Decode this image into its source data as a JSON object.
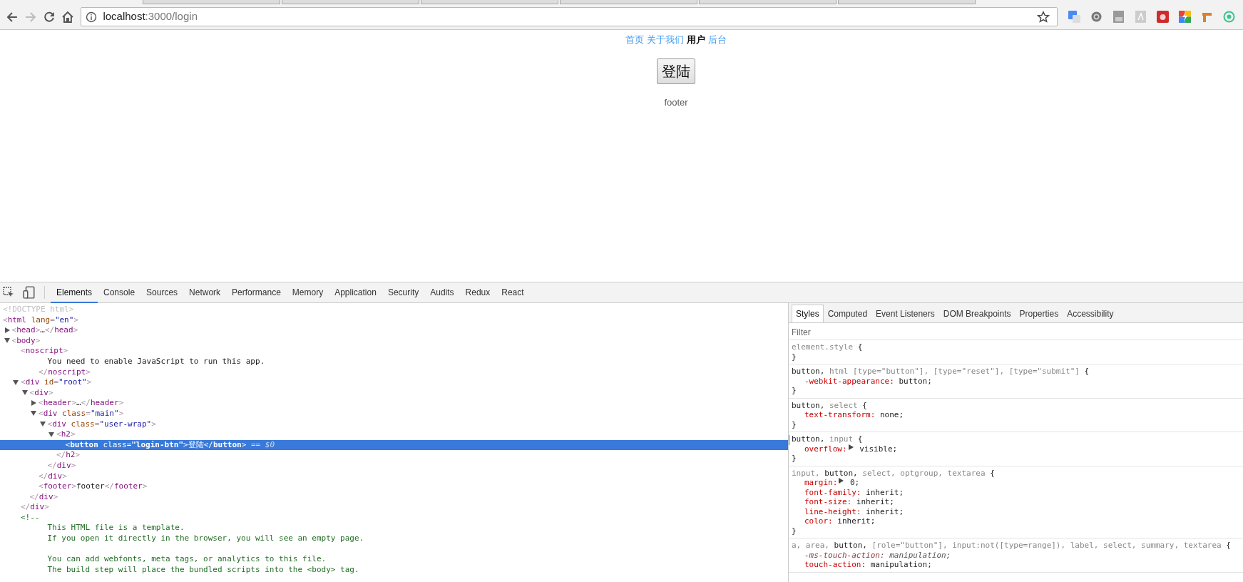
{
  "browser": {
    "url_host": "localhost",
    "url_path": ":3000/login"
  },
  "page": {
    "nav": [
      {
        "label": "首页",
        "selected": false
      },
      {
        "label": "关于我们",
        "selected": false
      },
      {
        "label": "用户",
        "selected": true
      },
      {
        "label": "后台",
        "selected": false
      }
    ],
    "login_button": "登陆",
    "footer": "footer"
  },
  "devtools": {
    "tabs": [
      {
        "label": "Elements",
        "selected": true
      },
      {
        "label": "Console",
        "selected": false
      },
      {
        "label": "Sources",
        "selected": false
      },
      {
        "label": "Network",
        "selected": false
      },
      {
        "label": "Performance",
        "selected": false
      },
      {
        "label": "Memory",
        "selected": false
      },
      {
        "label": "Application",
        "selected": false
      },
      {
        "label": "Security",
        "selected": false
      },
      {
        "label": "Audits",
        "selected": false
      },
      {
        "label": "Redux",
        "selected": false
      },
      {
        "label": "React",
        "selected": false
      }
    ],
    "dom": [
      {
        "selected": false,
        "open": [
          {
            "kind": "doctype",
            "text": "<!DOCTYPE html>"
          }
        ]
      },
      {
        "selected": false,
        "open": [
          {
            "kind": "punct",
            "text": "<"
          },
          {
            "kind": "tag",
            "text": "html"
          },
          {
            "kind": "attr",
            "text": " lang"
          },
          {
            "kind": "punct",
            "text": "="
          },
          {
            "kind": "val",
            "text": "\"en\""
          },
          {
            "kind": "punct",
            "text": ">"
          }
        ],
        "children": [
          {
            "selected": false,
            "expanded": false,
            "open": [
              {
                "kind": "punct",
                "text": "<"
              },
              {
                "kind": "tag",
                "text": "head"
              },
              {
                "kind": "punct",
                "text": ">"
              },
              {
                "kind": "text",
                "text": "…"
              },
              {
                "kind": "punct",
                "text": "</"
              },
              {
                "kind": "tag",
                "text": "head"
              },
              {
                "kind": "punct",
                "text": ">"
              }
            ]
          },
          {
            "selected": false,
            "expanded": true,
            "open": [
              {
                "kind": "punct",
                "text": "<"
              },
              {
                "kind": "tag",
                "text": "body"
              },
              {
                "kind": "punct",
                "text": ">"
              }
            ],
            "children": [
              {
                "selected": false,
                "open": [
                  {
                    "kind": "punct",
                    "text": "<"
                  },
                  {
                    "kind": "tag",
                    "text": "noscript"
                  },
                  {
                    "kind": "punct",
                    "text": ">"
                  }
                ],
                "children": [
                  {
                    "selected": false,
                    "text": "You need to enable JavaScript to run this app."
                  }
                ],
                "close": [
                  {
                    "kind": "punct",
                    "text": "</"
                  },
                  {
                    "kind": "tag",
                    "text": "noscript"
                  },
                  {
                    "kind": "punct",
                    "text": ">"
                  }
                ]
              },
              {
                "selected": false,
                "expanded": true,
                "open": [
                  {
                    "kind": "punct",
                    "text": "<"
                  },
                  {
                    "kind": "tag",
                    "text": "div"
                  },
                  {
                    "kind": "attr",
                    "text": " id"
                  },
                  {
                    "kind": "punct",
                    "text": "="
                  },
                  {
                    "kind": "val",
                    "text": "\"root\""
                  },
                  {
                    "kind": "punct",
                    "text": ">"
                  }
                ],
                "children": [
                  {
                    "selected": false,
                    "expanded": true,
                    "open": [
                      {
                        "kind": "punct",
                        "text": "<"
                      },
                      {
                        "kind": "tag",
                        "text": "div"
                      },
                      {
                        "kind": "punct",
                        "text": ">"
                      }
                    ],
                    "children": [
                      {
                        "selected": false,
                        "expanded": false,
                        "open": [
                          {
                            "kind": "punct",
                            "text": "<"
                          },
                          {
                            "kind": "tag",
                            "text": "header"
                          },
                          {
                            "kind": "punct",
                            "text": ">"
                          },
                          {
                            "kind": "text",
                            "text": "…"
                          },
                          {
                            "kind": "punct",
                            "text": "</"
                          },
                          {
                            "kind": "tag",
                            "text": "header"
                          },
                          {
                            "kind": "punct",
                            "text": ">"
                          }
                        ]
                      },
                      {
                        "selected": false,
                        "expanded": true,
                        "open": [
                          {
                            "kind": "punct",
                            "text": "<"
                          },
                          {
                            "kind": "tag",
                            "text": "div"
                          },
                          {
                            "kind": "attr",
                            "text": " class"
                          },
                          {
                            "kind": "punct",
                            "text": "="
                          },
                          {
                            "kind": "val",
                            "text": "\"main\""
                          },
                          {
                            "kind": "punct",
                            "text": ">"
                          }
                        ],
                        "children": [
                          {
                            "selected": false,
                            "expanded": true,
                            "open": [
                              {
                                "kind": "punct",
                                "text": "<"
                              },
                              {
                                "kind": "tag",
                                "text": "div"
                              },
                              {
                                "kind": "attr",
                                "text": " class"
                              },
                              {
                                "kind": "punct",
                                "text": "="
                              },
                              {
                                "kind": "val",
                                "text": "\"user-wrap\""
                              },
                              {
                                "kind": "punct",
                                "text": ">"
                              }
                            ],
                            "children": [
                              {
                                "selected": false,
                                "expanded": true,
                                "open": [
                                  {
                                    "kind": "punct",
                                    "text": "<"
                                  },
                                  {
                                    "kind": "tag",
                                    "text": "h2"
                                  },
                                  {
                                    "kind": "punct",
                                    "text": ">"
                                  }
                                ],
                                "children": [
                                  {
                                    "selected": true,
                                    "marker": " == $0",
                                    "open": [
                                      {
                                        "kind": "punct",
                                        "text": "<"
                                      },
                                      {
                                        "kind": "tag",
                                        "text": "button"
                                      },
                                      {
                                        "kind": "attr",
                                        "text": " class"
                                      },
                                      {
                                        "kind": "punct",
                                        "text": "="
                                      },
                                      {
                                        "kind": "val",
                                        "text": "\"login-btn\""
                                      },
                                      {
                                        "kind": "punct",
                                        "text": ">"
                                      },
                                      {
                                        "kind": "text",
                                        "text": "登陆"
                                      },
                                      {
                                        "kind": "punct",
                                        "text": "</"
                                      },
                                      {
                                        "kind": "tag",
                                        "text": "button"
                                      },
                                      {
                                        "kind": "punct",
                                        "text": ">"
                                      }
                                    ]
                                  }
                                ],
                                "close": [
                                  {
                                    "kind": "punct",
                                    "text": "</"
                                  },
                                  {
                                    "kind": "tag",
                                    "text": "h2"
                                  },
                                  {
                                    "kind": "punct",
                                    "text": ">"
                                  }
                                ]
                              }
                            ],
                            "close": [
                              {
                                "kind": "punct",
                                "text": "</"
                              },
                              {
                                "kind": "tag",
                                "text": "div"
                              },
                              {
                                "kind": "punct",
                                "text": ">"
                              }
                            ]
                          }
                        ],
                        "close": [
                          {
                            "kind": "punct",
                            "text": "</"
                          },
                          {
                            "kind": "tag",
                            "text": "div"
                          },
                          {
                            "kind": "punct",
                            "text": ">"
                          }
                        ]
                      },
                      {
                        "selected": false,
                        "open": [
                          {
                            "kind": "punct",
                            "text": "<"
                          },
                          {
                            "kind": "tag",
                            "text": "footer"
                          },
                          {
                            "kind": "punct",
                            "text": ">"
                          },
                          {
                            "kind": "text",
                            "text": "footer"
                          },
                          {
                            "kind": "punct",
                            "text": "</"
                          },
                          {
                            "kind": "tag",
                            "text": "footer"
                          },
                          {
                            "kind": "punct",
                            "text": ">"
                          }
                        ]
                      }
                    ],
                    "close": [
                      {
                        "kind": "punct",
                        "text": "</"
                      },
                      {
                        "kind": "tag",
                        "text": "div"
                      },
                      {
                        "kind": "punct",
                        "text": ">"
                      }
                    ]
                  }
                ],
                "close": [
                  {
                    "kind": "punct",
                    "text": "</"
                  },
                  {
                    "kind": "tag",
                    "text": "div"
                  },
                  {
                    "kind": "punct",
                    "text": ">"
                  }
                ]
              },
              {
                "selected": false,
                "comment": "<!--",
                "paragraphs": [
                  [
                    "This HTML file is a template.",
                    "If you open it directly in the browser, you will see an empty page."
                  ],
                  [
                    "You can add webfonts, meta tags, or analytics to this file.",
                    "The build step will place the bundled scripts into the <body> tag."
                  ]
                ]
              }
            ]
          }
        ]
      }
    ],
    "side_tabs": [
      {
        "label": "Styles",
        "selected": true
      },
      {
        "label": "Computed",
        "selected": false
      },
      {
        "label": "Event Listeners",
        "selected": false
      },
      {
        "label": "DOM Breakpoints",
        "selected": false
      },
      {
        "label": "Properties",
        "selected": false
      },
      {
        "label": "Accessibility",
        "selected": false
      }
    ],
    "filter": {
      "placeholder": "Filter"
    },
    "rules": [
      {
        "marked": false,
        "selector": [
          {
            "text": "element.style",
            "matched": false
          },
          {
            "text": " {",
            "matched": true
          }
        ],
        "close": "}"
      },
      {
        "marked": false,
        "selector": [
          {
            "text": "button,",
            "matched": true
          },
          {
            "text": " html [type=\"button\"], [type=\"reset\"], [type=\"submit\"]",
            "matched": false
          },
          {
            "text": " {",
            "matched": true
          }
        ],
        "props": [
          {
            "name": "-webkit-appearance:",
            "value": " button;",
            "expandable": false,
            "overridden": false
          }
        ],
        "close": "}"
      },
      {
        "marked": false,
        "selector": [
          {
            "text": "button,",
            "matched": true
          },
          {
            "text": " select",
            "matched": false
          },
          {
            "text": " {",
            "matched": true
          }
        ],
        "props": [
          {
            "name": "text-transform:",
            "value": " none;",
            "expandable": false,
            "overridden": false
          }
        ],
        "close": "}"
      },
      {
        "marked": true,
        "selector": [
          {
            "text": "button,",
            "matched": true
          },
          {
            "text": " input",
            "matched": false
          },
          {
            "text": " {",
            "matched": true
          }
        ],
        "props": [
          {
            "name": "overflow:",
            "value": " visible;",
            "expandable": true,
            "overridden": false
          }
        ],
        "close": "}"
      },
      {
        "marked": false,
        "selector": [
          {
            "text": "input, ",
            "matched": false
          },
          {
            "text": "button,",
            "matched": true
          },
          {
            "text": " select, optgroup, textarea",
            "matched": false
          },
          {
            "text": " {",
            "matched": true
          }
        ],
        "props": [
          {
            "name": "margin:",
            "value": " 0;",
            "expandable": true,
            "overridden": false
          },
          {
            "name": "font-family:",
            "value": " inherit;",
            "expandable": false,
            "overridden": false
          },
          {
            "name": "font-size:",
            "value": " inherit;",
            "expandable": false,
            "overridden": false
          },
          {
            "name": "line-height:",
            "value": " inherit;",
            "expandable": false,
            "overridden": false
          },
          {
            "name": "color:",
            "value": " inherit;",
            "expandable": false,
            "overridden": false
          }
        ],
        "close": "}"
      },
      {
        "marked": false,
        "selector": [
          {
            "text": "a, area, ",
            "matched": false
          },
          {
            "text": "button,",
            "matched": true
          },
          {
            "text": " [role=\"button\"], input:not([type=range]), label, select, summary, textarea",
            "matched": false
          },
          {
            "text": " {",
            "matched": true
          }
        ],
        "props": [
          {
            "name": "-ms-touch-action:",
            "value": " manipulation;",
            "expandable": false,
            "overridden": true
          },
          {
            "name": "touch-action:",
            "value": " manipulation;",
            "expandable": false,
            "overridden": false
          }
        ]
      }
    ]
  }
}
